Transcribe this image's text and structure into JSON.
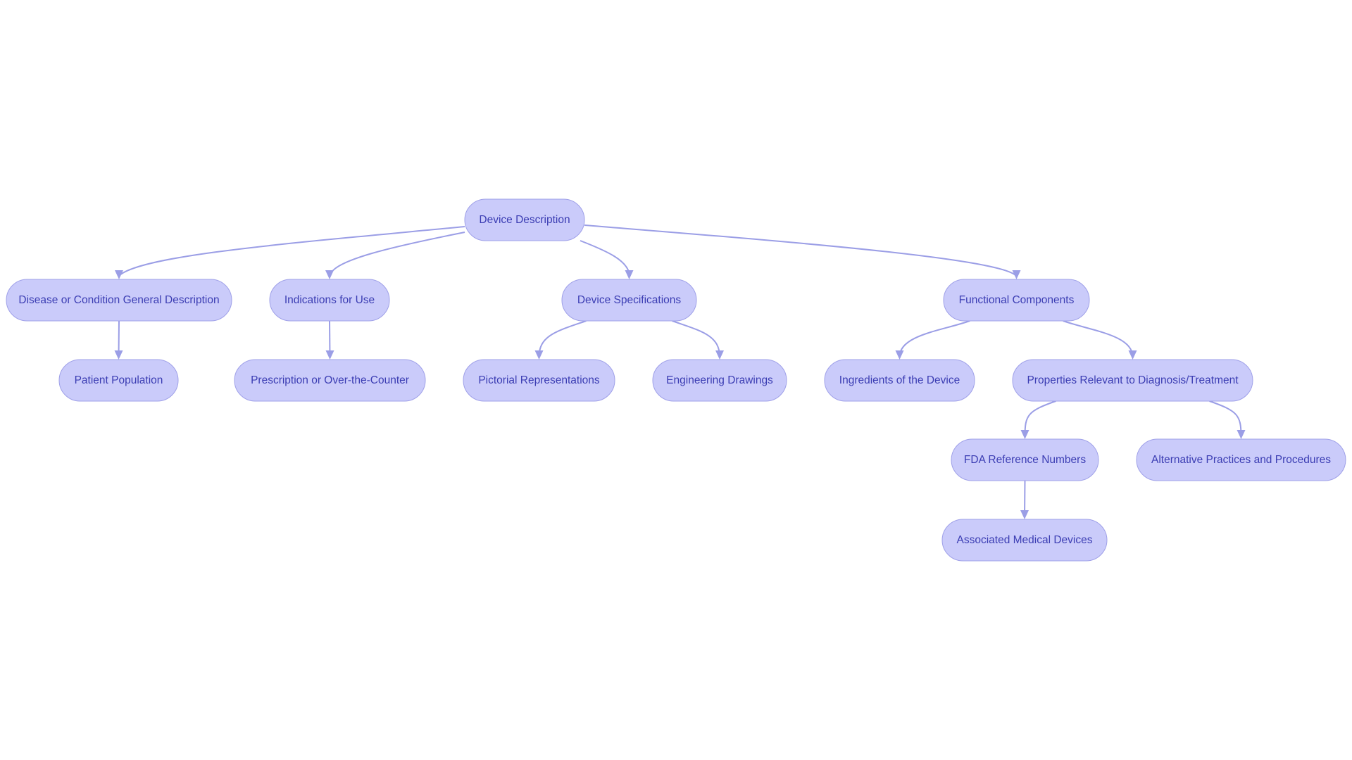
{
  "diagram": {
    "type": "flowchart-tree",
    "colors": {
      "node_fill": "#cacbfa",
      "node_stroke": "#9fa0e8",
      "label": "#3b3db3",
      "edge": "#9b9ee6",
      "background": "#ffffff"
    },
    "nodes": [
      {
        "id": "device_description",
        "label": "Device Description"
      },
      {
        "id": "disease",
        "label": "Disease or Condition General Description"
      },
      {
        "id": "indications",
        "label": "Indications for Use"
      },
      {
        "id": "device_specs",
        "label": "Device Specifications"
      },
      {
        "id": "functional",
        "label": "Functional Components"
      },
      {
        "id": "patient",
        "label": "Patient Population"
      },
      {
        "id": "prescription",
        "label": "Prescription or Over-the-Counter"
      },
      {
        "id": "pictorial",
        "label": "Pictorial Representations"
      },
      {
        "id": "engineering",
        "label": "Engineering Drawings"
      },
      {
        "id": "ingredients",
        "label": "Ingredients of the Device"
      },
      {
        "id": "properties",
        "label": "Properties Relevant to Diagnosis/Treatment"
      },
      {
        "id": "fda",
        "label": "FDA Reference Numbers"
      },
      {
        "id": "alternative",
        "label": "Alternative Practices and Procedures"
      },
      {
        "id": "associated",
        "label": "Associated Medical Devices"
      }
    ],
    "edges": [
      {
        "from": "device_description",
        "to": "disease"
      },
      {
        "from": "device_description",
        "to": "indications"
      },
      {
        "from": "device_description",
        "to": "device_specs"
      },
      {
        "from": "device_description",
        "to": "functional"
      },
      {
        "from": "disease",
        "to": "patient"
      },
      {
        "from": "indications",
        "to": "prescription"
      },
      {
        "from": "device_specs",
        "to": "pictorial"
      },
      {
        "from": "device_specs",
        "to": "engineering"
      },
      {
        "from": "functional",
        "to": "ingredients"
      },
      {
        "from": "functional",
        "to": "properties"
      },
      {
        "from": "properties",
        "to": "fda"
      },
      {
        "from": "properties",
        "to": "alternative"
      },
      {
        "from": "fda",
        "to": "associated"
      }
    ]
  }
}
